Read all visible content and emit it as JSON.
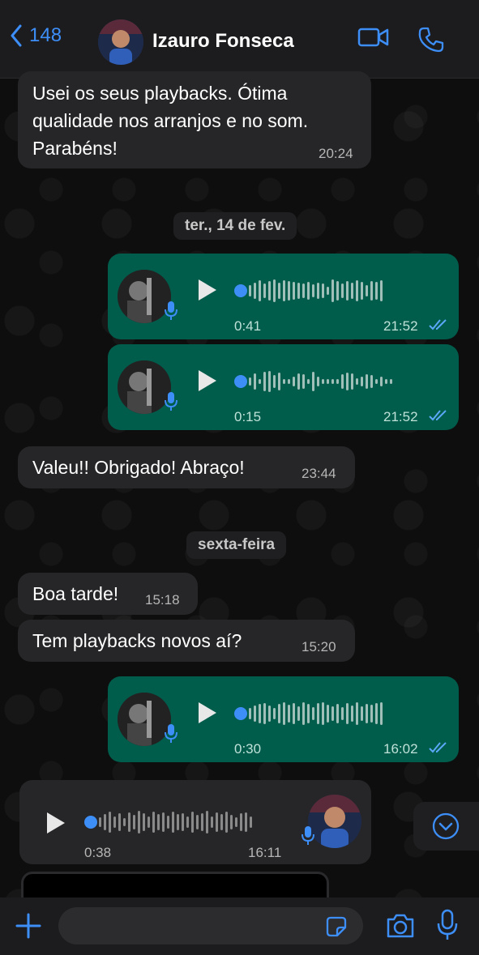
{
  "header": {
    "back_count": "148",
    "contact_name": "Izauro Fonseca",
    "icons": [
      "chevron-left-icon",
      "video-call-icon",
      "phone-icon"
    ]
  },
  "messages": {
    "m1_text": "Usei os seus playbacks. Ótima qualidade nos arranjos e no som. Parabéns!",
    "m1_time": "20:24",
    "date1": "ter., 14 de fev.",
    "a1_duration": "0:41",
    "a1_time": "21:52",
    "a2_duration": "0:15",
    "a2_time": "21:52",
    "m2_text": "Valeu!! Obrigado! Abraço!",
    "m2_time": "23:44",
    "date2": "sexta-feira",
    "m3_text": "Boa tarde!",
    "m3_time": "15:18",
    "m4_text": "Tem playbacks novos aí?",
    "m4_time": "15:20",
    "a3_duration": "0:30",
    "a3_time": "16:02",
    "a4_duration": "0:38",
    "a4_time": "16:11"
  },
  "colors": {
    "accent": "#3d8ef7",
    "outgoing_bubble": "#005c4b",
    "incoming_bubble": "#262628"
  }
}
